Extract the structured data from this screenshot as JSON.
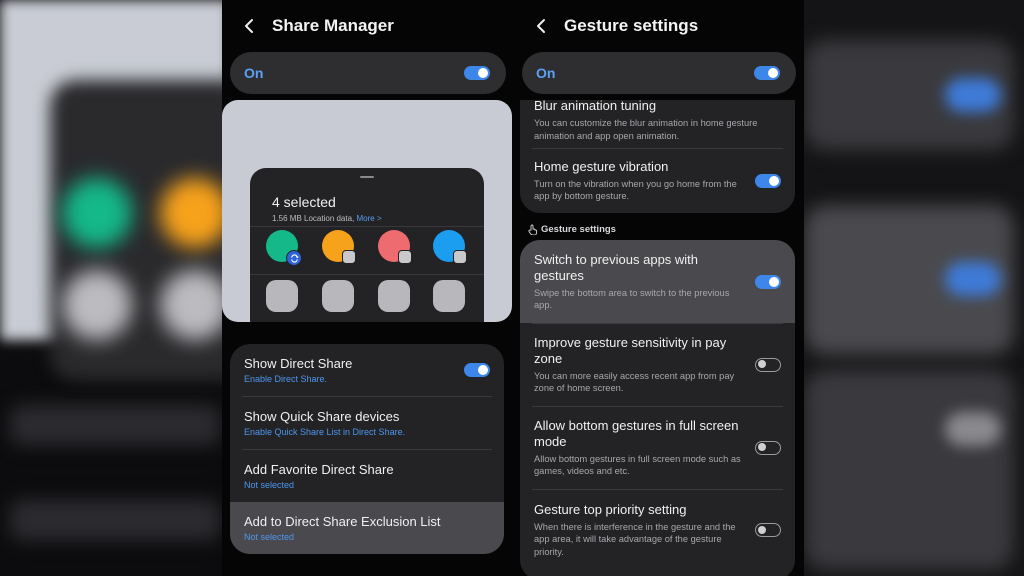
{
  "share_manager": {
    "title": "Share Manager",
    "master_label": "On",
    "master_on": true,
    "preview": {
      "title": "4 selected",
      "subtitle": "1.56 MB Location data,",
      "more_link": "More >"
    },
    "rows": [
      {
        "title": "Show Direct Share",
        "subtitle": "Enable Direct Share.",
        "toggle": true
      },
      {
        "title": "Show Quick Share devices",
        "subtitle": "Enable Quick Share List in Direct Share."
      },
      {
        "title": "Add Favorite Direct Share",
        "subtitle": "Not selected"
      },
      {
        "title": "Add to Direct Share Exclusion List",
        "subtitle": "Not selected"
      }
    ]
  },
  "gesture_settings": {
    "title": "Gesture settings",
    "master_label": "On",
    "master_on": true,
    "top_rows": [
      {
        "title": "Blur animation tuning",
        "desc": "You can customize the blur animation in home gesture animation and app open animation."
      },
      {
        "title": "Home gesture vibration",
        "desc": "Turn on the vibration when you go home from the app by bottom gesture.",
        "toggle": true
      }
    ],
    "section_label": "Gesture settings",
    "rows": [
      {
        "title": "Switch to previous apps with gestures",
        "desc": "Swipe the bottom area to switch to the previous app.",
        "toggle": true
      },
      {
        "title": "Improve gesture sensitivity in pay zone",
        "desc": "You can more easily access recent app from pay zone of home screen.",
        "toggle": false
      },
      {
        "title": "Allow bottom gestures in full screen mode",
        "desc": "Allow bottom gestures in full screen mode such as games, videos and etc.",
        "toggle": false
      },
      {
        "title": "Gesture top priority setting",
        "desc": "When there is interference in the gesture and the app area, it will take advantage of the gesture priority.",
        "toggle": false
      }
    ]
  },
  "colors": {
    "accent": "#3d86ea",
    "link": "#4e96ee",
    "card": "#232326",
    "selected_row": "#4a4a4e",
    "app_green": "#14b889",
    "app_orange": "#f7a21b",
    "app_red": "#ee6b6f",
    "app_blue": "#1b9df0"
  }
}
